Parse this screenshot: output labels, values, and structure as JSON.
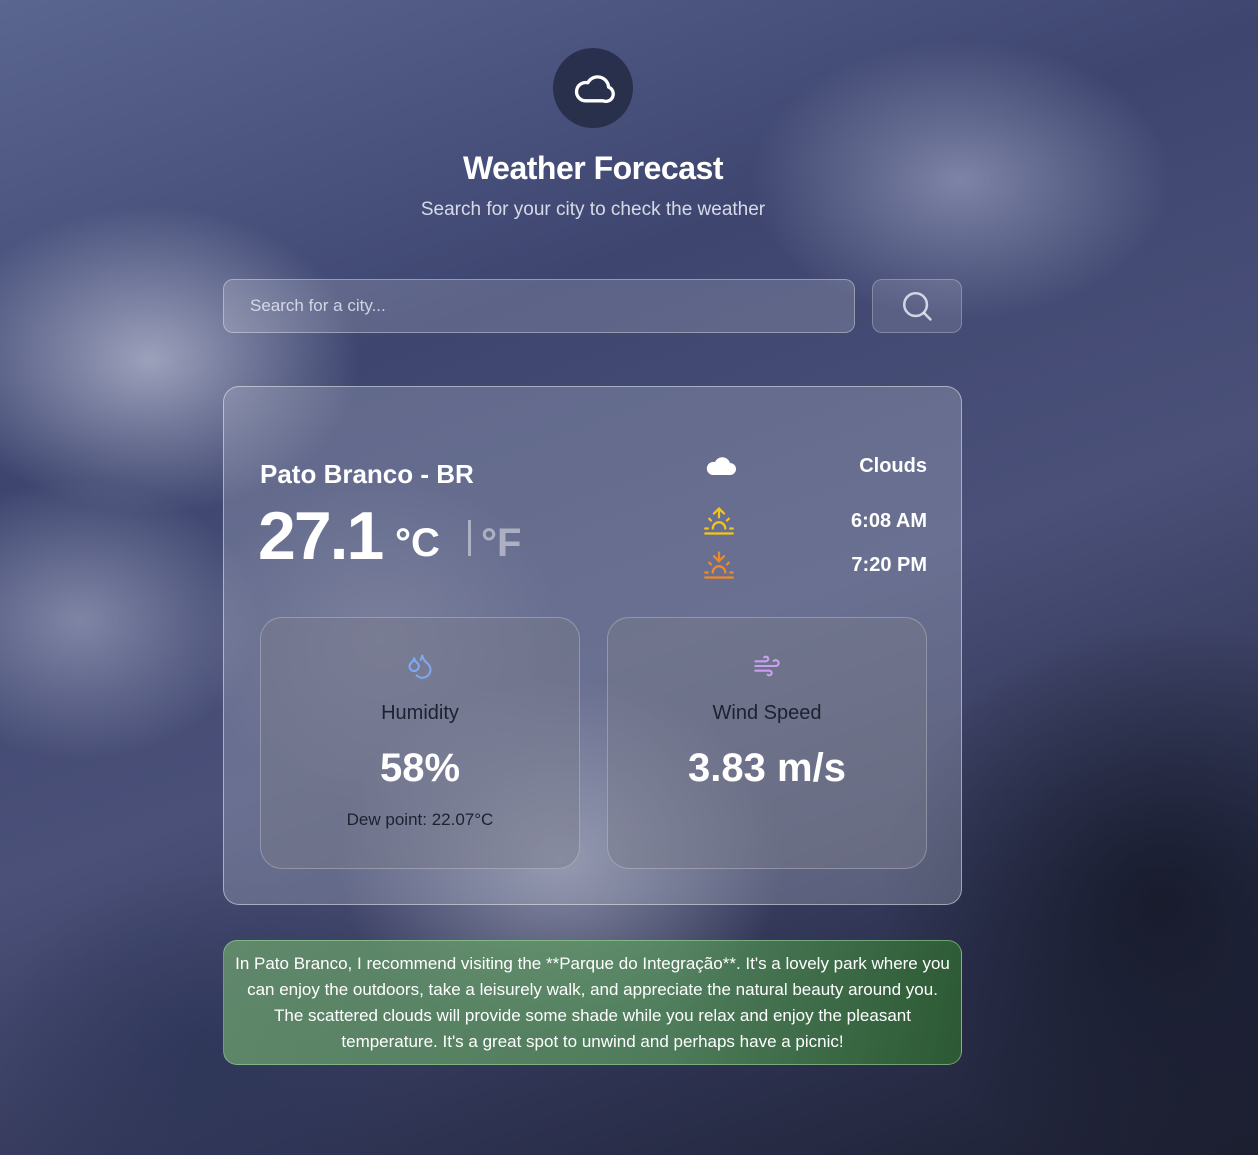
{
  "header": {
    "logo_icon": "cloud-icon",
    "title": "Weather Forecast",
    "subtitle": "Search for your city to check the weather"
  },
  "search": {
    "placeholder": "Search for a city...",
    "value": "",
    "button_icon": "search-icon"
  },
  "weather": {
    "city": "Pato Branco - BR",
    "temperature": "27.1",
    "unit_celsius": "°C",
    "unit_fahrenheit": "°F",
    "selected_unit": "°C",
    "condition": "Clouds",
    "condition_icon": "cloud-icon",
    "sunrise": "6:08 AM",
    "sunrise_icon": "sunrise-icon",
    "sunset": "7:20 PM",
    "sunset_icon": "sunset-icon"
  },
  "humidity": {
    "icon": "droplets-icon",
    "label": "Humidity",
    "value": "58%",
    "dew_point": "Dew point: 22.07°C"
  },
  "wind": {
    "icon": "wind-icon",
    "label": "Wind Speed",
    "value": "3.83 m/s"
  },
  "recommendation": {
    "text": "In Pato Branco, I recommend visiting the **Parque do Integração**. It's a lovely park where you can enjoy the outdoors, take a leisurely walk, and appreciate the natural beauty around you. The scattered clouds will provide some shade while you relax and enjoy the pleasant temperature. It's a great spot to unwind and perhaps have a picnic!"
  },
  "colors": {
    "sunrise": "#f5c518",
    "sunset": "#f08a24",
    "humidity_icon": "#7fa8f0",
    "wind_icon": "#c9a0f0",
    "recommendation_bg": "#6ea06e"
  }
}
